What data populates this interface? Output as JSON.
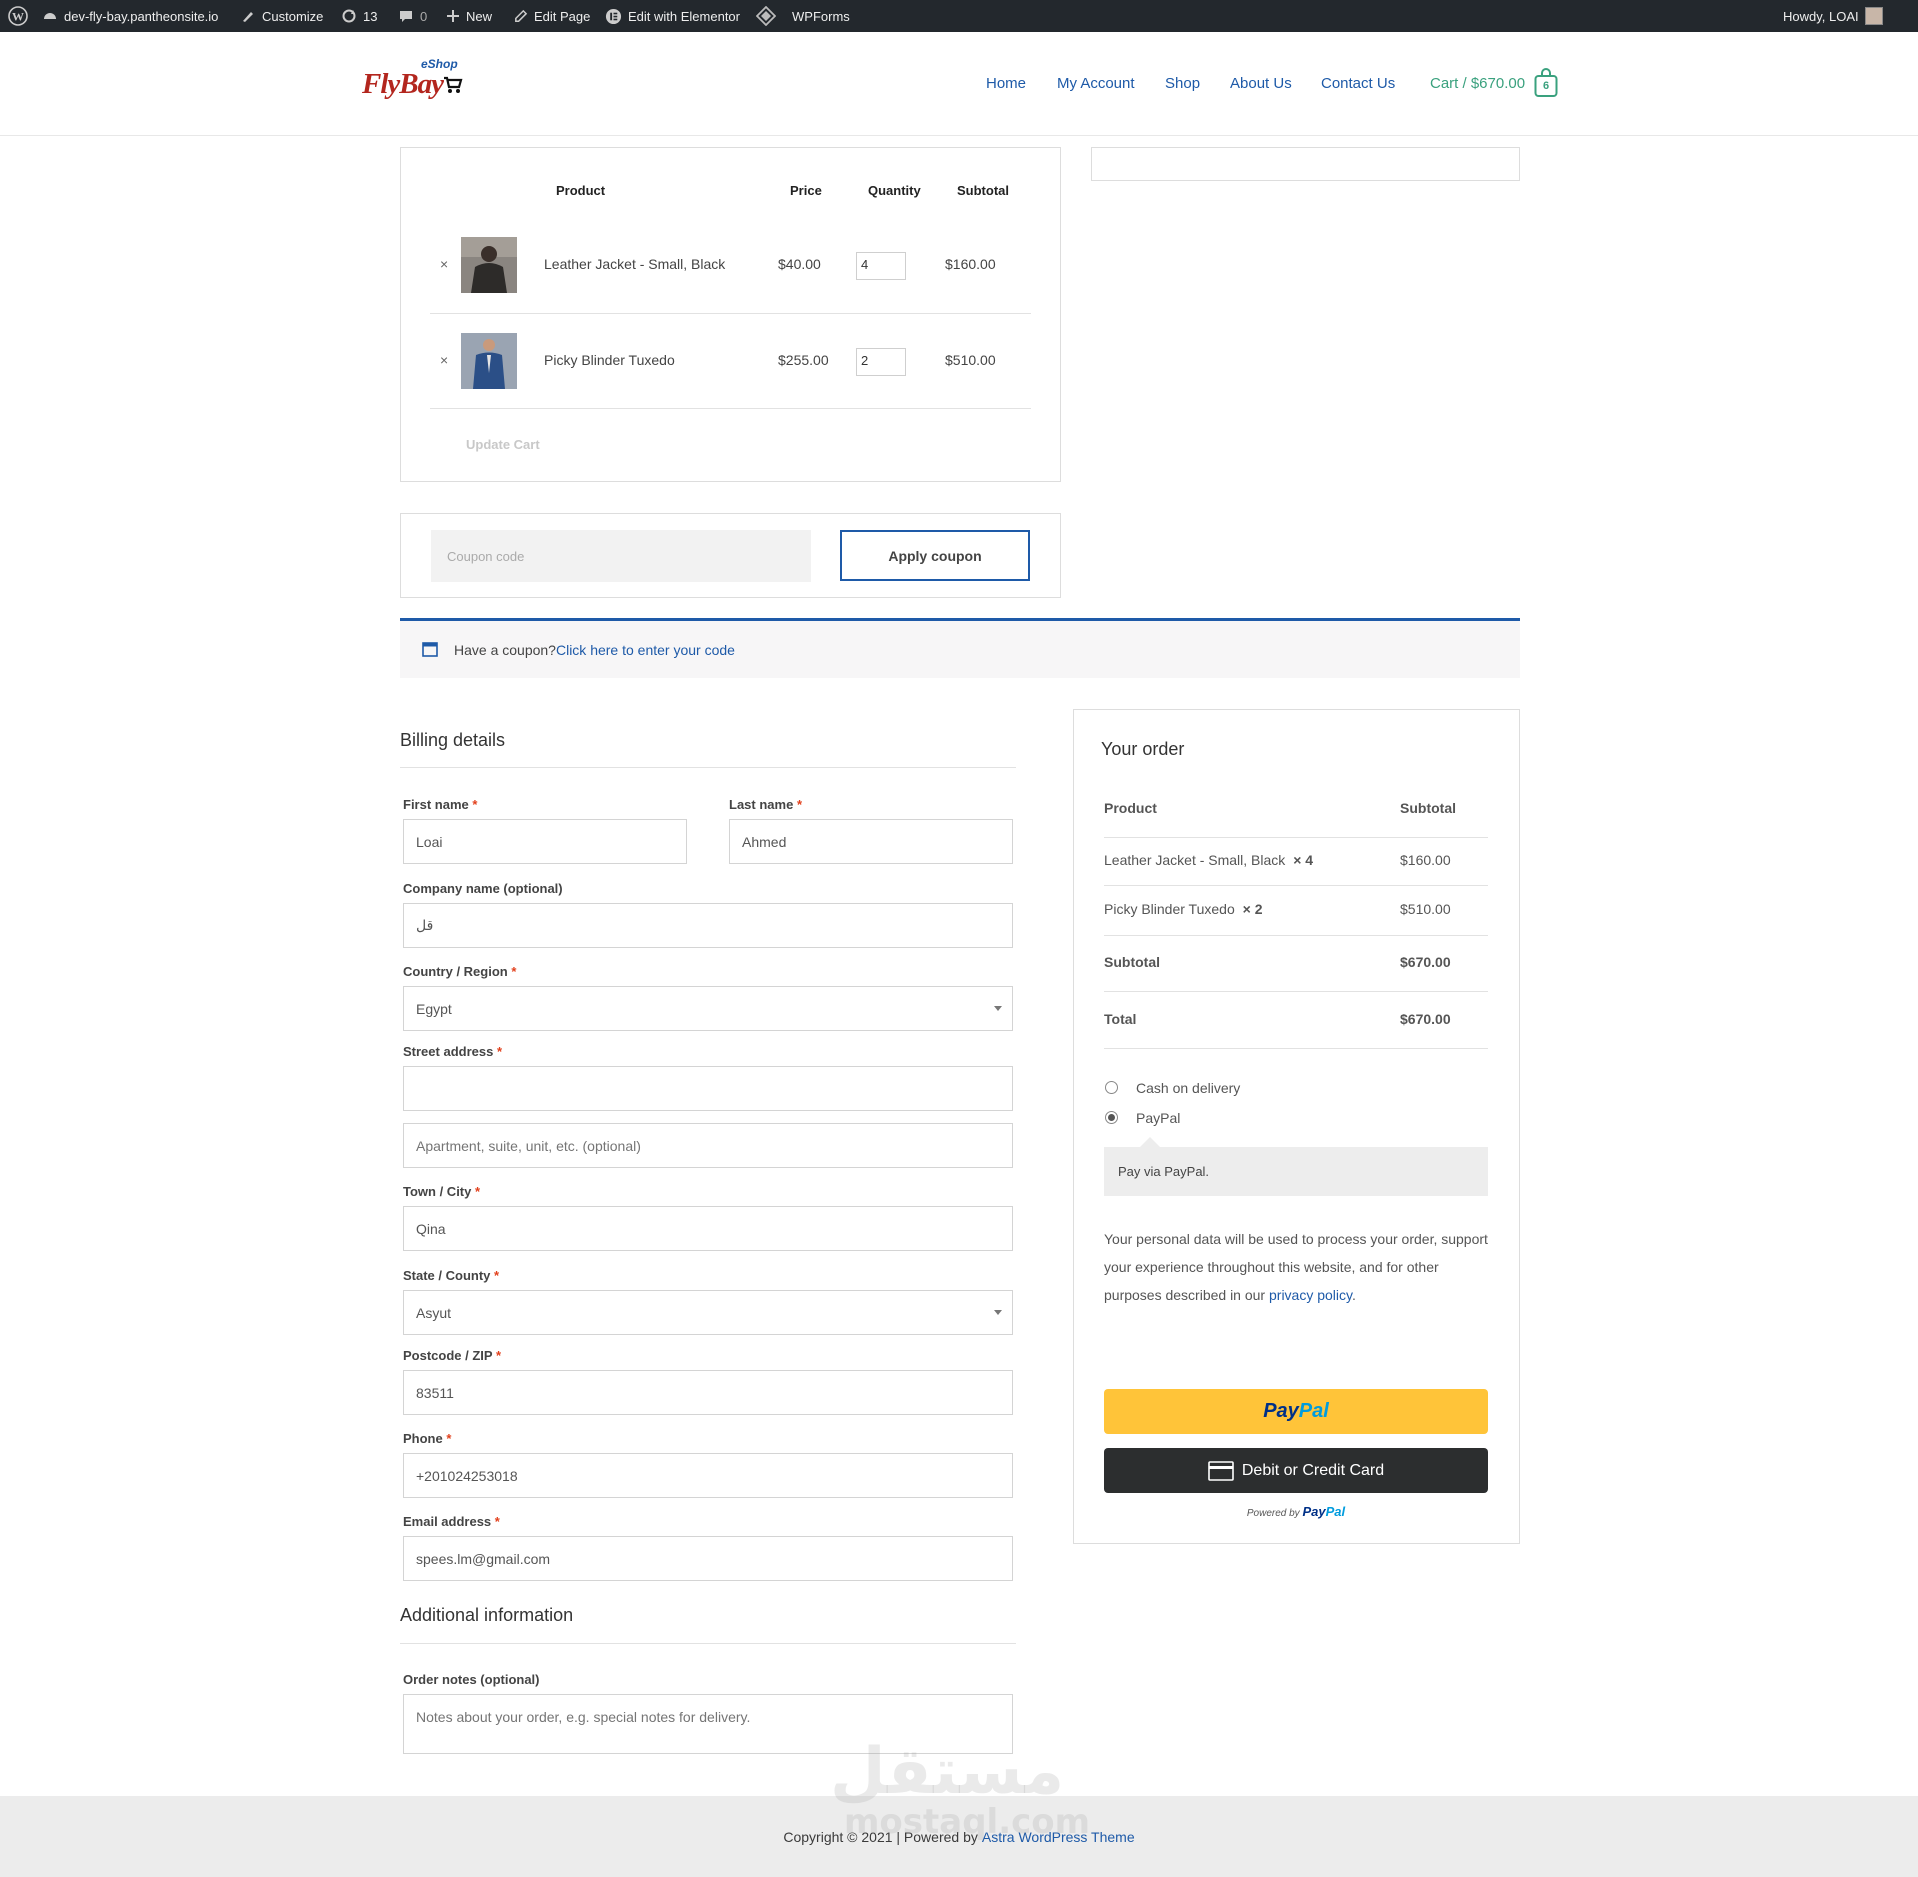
{
  "admin_bar": {
    "site": "dev-fly-bay.pantheonsite.io",
    "customize": "Customize",
    "updates": "13",
    "comments": "0",
    "new": "New",
    "edit_page": "Edit Page",
    "elementor": "Edit with Elementor",
    "wpforms": "WPForms",
    "howdy": "Howdy, LOAI"
  },
  "header": {
    "logo_top": "eShop",
    "logo_main": "FlyBay",
    "nav": [
      "Home",
      "My Account",
      "Shop",
      "About Us",
      "Contact Us"
    ],
    "cart": "Cart / $670.00",
    "cart_count": "6"
  },
  "cart": {
    "headers": [
      "Product",
      "Price",
      "Quantity",
      "Subtotal"
    ],
    "items": [
      {
        "name": "Leather Jacket - Small, Black",
        "price": "$40.00",
        "qty": "4",
        "subtotal": "$160.00"
      },
      {
        "name": "Picky Blinder Tuxedo",
        "price": "$255.00",
        "qty": "2",
        "subtotal": "$510.00"
      }
    ],
    "remove_glyph": "×",
    "update_label": "Update Cart"
  },
  "coupon": {
    "placeholder": "Coupon code",
    "apply_label": "Apply coupon"
  },
  "notice": {
    "text": "Have a coupon? ",
    "link": "Click here to enter your code"
  },
  "billing": {
    "title": "Billing details",
    "first_name_label": "First name",
    "first_name": "Loai",
    "last_name_label": "Last name",
    "last_name": "Ahmed",
    "company_label": "Company name (optional)",
    "company": "قل",
    "country_label": "Country / Region",
    "country": "Egypt",
    "street_label": "Street address",
    "street": "",
    "apt_placeholder": "Apartment, suite, unit, etc. (optional)",
    "city_label": "Town / City",
    "city": "Qina",
    "state_label": "State / County",
    "state": "Asyut",
    "zip_label": "Postcode / ZIP",
    "zip": "83511",
    "phone_label": "Phone",
    "phone": "+201024253018",
    "email_label": "Email address",
    "email": "spees.lm@gmail.com",
    "required_mark": "*"
  },
  "additional": {
    "title": "Additional information",
    "notes_label": "Order notes (optional)",
    "notes_placeholder": "Notes about your order, e.g. special notes for delivery."
  },
  "order": {
    "title": "Your order",
    "col_product": "Product",
    "col_subtotal": "Subtotal",
    "items": [
      {
        "name": "Leather Jacket - Small, Black",
        "qty": "× 4",
        "subtotal": "$160.00"
      },
      {
        "name": "Picky Blinder Tuxedo",
        "qty": "× 2",
        "subtotal": "$510.00"
      }
    ],
    "subtotal_label": "Subtotal",
    "subtotal": "$670.00",
    "total_label": "Total",
    "total": "$670.00",
    "payment_cod": "Cash on delivery",
    "payment_paypal": "PayPal",
    "paypal_desc": "Pay via PayPal.",
    "privacy_text": "Your personal data will be used to process your order, support your experience throughout this website, and for other purposes described in our ",
    "privacy_link": "privacy policy",
    "privacy_end": ".",
    "paypal_btn_pay": "Pay",
    "paypal_btn_pal": "Pal",
    "card_btn": "Debit or Credit Card",
    "powered_by": "Powered by ",
    "powered_pay": "Pay",
    "powered_pal": "Pal"
  },
  "footer": {
    "copyright": "Copyright © 2021 | Powered by ",
    "theme_link": "Astra WordPress Theme"
  },
  "watermark": {
    "arabic": "مستقل",
    "latin": "mostaql.com"
  },
  "colors": {
    "admin_bar": "#23282d",
    "link_blue": "#1e5aa8",
    "cart_green": "#3aa17e",
    "paypal_yellow": "#ffc439",
    "card_dark": "#2c2e2f",
    "required_red": "#e2401c"
  }
}
